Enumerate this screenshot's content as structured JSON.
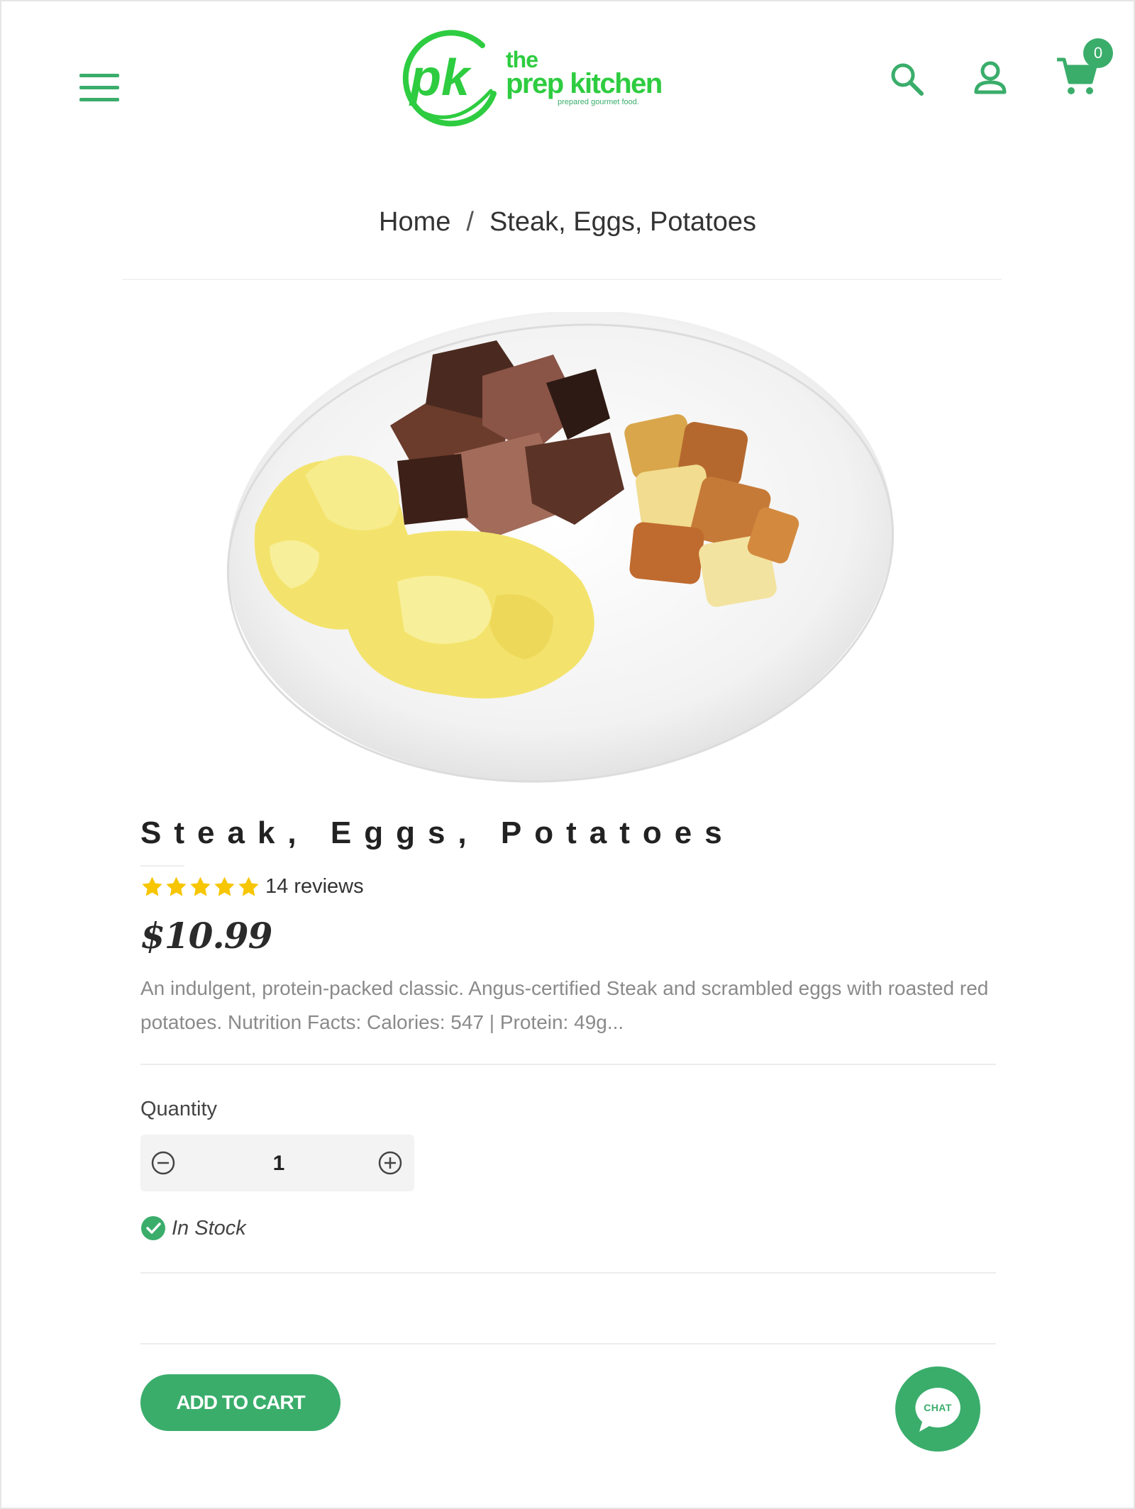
{
  "brand": {
    "logo_mark": "pk",
    "name_line1": "the",
    "name_line2": "prep kitchen",
    "tagline": "prepared gourmet food.",
    "accent_color": "#3aad6b",
    "logo_color": "#2ecc40"
  },
  "header": {
    "menu_icon": "hamburger-menu-icon",
    "search_icon": "search-icon",
    "account_icon": "account-icon",
    "cart_icon": "cart-icon",
    "cart_count": "0"
  },
  "breadcrumb": {
    "home": "Home",
    "separator": "/",
    "current": "Steak, Eggs, Potatoes"
  },
  "product": {
    "title": "Steak, Eggs, Potatoes",
    "rating": 5,
    "reviews": "14 reviews",
    "price": "$10.99",
    "description": "An indulgent, protein-packed classic. Angus-certified Steak and scrambled eggs with roasted red potatoes. Nutrition Facts:  Calories: 547 | Protein: 49g...",
    "quantity_label": "Quantity",
    "quantity_value": "1",
    "stock_status": "In Stock",
    "add_to_cart": "ADD TO CART"
  },
  "chat": {
    "label": "CHAT"
  }
}
